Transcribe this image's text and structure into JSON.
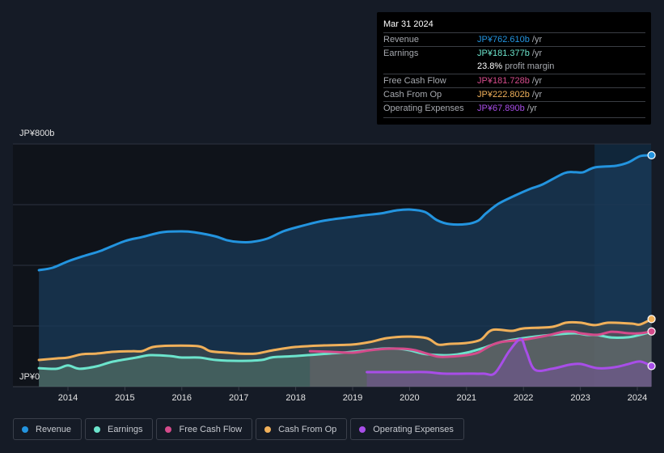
{
  "tooltip": {
    "date": "Mar 31 2024",
    "rows": [
      {
        "label": "Revenue",
        "value": "JP¥762.610b",
        "unit": " /yr",
        "color": "#2394df"
      },
      {
        "label": "Earnings",
        "value": "JP¥181.377b",
        "unit": " /yr",
        "color": "#6ce4cc"
      },
      {
        "label": "",
        "value": "23.8%",
        "unit": " profit margin",
        "color": "#ffffff"
      },
      {
        "label": "Free Cash Flow",
        "value": "JP¥181.728b",
        "unit": " /yr",
        "color": "#d44b8b"
      },
      {
        "label": "Cash From Op",
        "value": "JP¥222.802b",
        "unit": " /yr",
        "color": "#f0b05a"
      },
      {
        "label": "Operating Expenses",
        "value": "JP¥67.890b",
        "unit": " /yr",
        "color": "#a84ee8"
      }
    ]
  },
  "legend": [
    {
      "label": "Revenue",
      "color": "#2394df"
    },
    {
      "label": "Earnings",
      "color": "#6ce4cc"
    },
    {
      "label": "Free Cash Flow",
      "color": "#d44b8b"
    },
    {
      "label": "Cash From Op",
      "color": "#f0b05a"
    },
    {
      "label": "Operating Expenses",
      "color": "#a84ee8"
    }
  ],
  "chart_data": {
    "type": "area",
    "title": "",
    "xlabel": "",
    "ylabel": "",
    "y_unit": "JP¥ billions",
    "ylim": [
      0,
      800
    ],
    "xlim": [
      2013.49,
      2024.25
    ],
    "y_tick_labels": [
      "JP¥0",
      "JP¥800b"
    ],
    "y_gridlines": [
      0,
      200,
      400,
      600,
      800
    ],
    "x_tick_labels": [
      "2014",
      "2015",
      "2016",
      "2017",
      "2018",
      "2019",
      "2020",
      "2021",
      "2022",
      "2023",
      "2024"
    ],
    "x_ticks": [
      2014,
      2015,
      2016,
      2017,
      2018,
      2019,
      2020,
      2021,
      2022,
      2023,
      2024
    ],
    "highlight_from": 2023.25,
    "legend_position": "bottom",
    "series": [
      {
        "name": "Revenue",
        "color": "#2394df",
        "points": [
          [
            2013.49,
            384
          ],
          [
            2013.73,
            392
          ],
          [
            2014.0,
            413
          ],
          [
            2014.3,
            432
          ],
          [
            2014.58,
            448
          ],
          [
            2015.0,
            480
          ],
          [
            2015.3,
            493
          ],
          [
            2015.65,
            509
          ],
          [
            2016.0,
            512
          ],
          [
            2016.22,
            509
          ],
          [
            2016.58,
            496
          ],
          [
            2016.79,
            483
          ],
          [
            2017.0,
            477
          ],
          [
            2017.22,
            477
          ],
          [
            2017.5,
            488
          ],
          [
            2017.78,
            512
          ],
          [
            2018.07,
            528
          ],
          [
            2018.49,
            547
          ],
          [
            2019.0,
            560
          ],
          [
            2019.2,
            565
          ],
          [
            2019.49,
            571
          ],
          [
            2019.77,
            581
          ],
          [
            2020.0,
            584
          ],
          [
            2020.27,
            576
          ],
          [
            2020.48,
            549
          ],
          [
            2020.7,
            536
          ],
          [
            2021.0,
            536
          ],
          [
            2021.2,
            547
          ],
          [
            2021.34,
            571
          ],
          [
            2021.56,
            603
          ],
          [
            2021.84,
            629
          ],
          [
            2022.13,
            653
          ],
          [
            2022.34,
            667
          ],
          [
            2022.72,
            704
          ],
          [
            2022.91,
            707
          ],
          [
            2023.05,
            707
          ],
          [
            2023.26,
            723
          ],
          [
            2023.62,
            728
          ],
          [
            2023.84,
            739
          ],
          [
            2024.05,
            760
          ],
          [
            2024.25,
            763
          ]
        ]
      },
      {
        "name": "Earnings",
        "color": "#6ce4cc",
        "points": [
          [
            2013.49,
            61
          ],
          [
            2013.8,
            59
          ],
          [
            2014.0,
            70
          ],
          [
            2014.2,
            59
          ],
          [
            2014.5,
            67
          ],
          [
            2014.8,
            83
          ],
          [
            2015.2,
            96
          ],
          [
            2015.45,
            104
          ],
          [
            2015.8,
            101
          ],
          [
            2016.0,
            96
          ],
          [
            2016.3,
            96
          ],
          [
            2016.6,
            88
          ],
          [
            2017.0,
            85
          ],
          [
            2017.4,
            88
          ],
          [
            2017.6,
            97
          ],
          [
            2018.0,
            101
          ],
          [
            2018.5,
            108
          ],
          [
            2019.0,
            115
          ],
          [
            2019.5,
            125
          ],
          [
            2019.8,
            125
          ],
          [
            2020.0,
            120
          ],
          [
            2020.3,
            107
          ],
          [
            2020.7,
            104
          ],
          [
            2021.0,
            112
          ],
          [
            2021.3,
            128
          ],
          [
            2021.6,
            147
          ],
          [
            2022.0,
            160
          ],
          [
            2022.5,
            171
          ],
          [
            2022.9,
            176
          ],
          [
            2023.1,
            171
          ],
          [
            2023.3,
            170
          ],
          [
            2023.55,
            162
          ],
          [
            2023.85,
            163
          ],
          [
            2024.05,
            171
          ],
          [
            2024.25,
            181
          ]
        ]
      },
      {
        "name": "Free Cash Flow",
        "color": "#d44b8b",
        "points": [
          [
            2018.25,
            117
          ],
          [
            2018.6,
            115
          ],
          [
            2019.0,
            112
          ],
          [
            2019.3,
            120
          ],
          [
            2019.6,
            125
          ],
          [
            2019.9,
            125
          ],
          [
            2020.1,
            120
          ],
          [
            2020.3,
            109
          ],
          [
            2020.5,
            99
          ],
          [
            2020.7,
            99
          ],
          [
            2021.0,
            104
          ],
          [
            2021.2,
            112
          ],
          [
            2021.4,
            133
          ],
          [
            2021.6,
            147
          ],
          [
            2022.0,
            155
          ],
          [
            2022.4,
            168
          ],
          [
            2022.7,
            181
          ],
          [
            2022.9,
            181
          ],
          [
            2023.0,
            176
          ],
          [
            2023.3,
            171
          ],
          [
            2023.55,
            181
          ],
          [
            2023.85,
            176
          ],
          [
            2024.05,
            176
          ],
          [
            2024.25,
            182
          ]
        ]
      },
      {
        "name": "Cash From Op",
        "color": "#f0b05a",
        "points": [
          [
            2013.49,
            88
          ],
          [
            2013.8,
            93
          ],
          [
            2014.0,
            96
          ],
          [
            2014.25,
            107
          ],
          [
            2014.5,
            109
          ],
          [
            2014.8,
            115
          ],
          [
            2015.15,
            117
          ],
          [
            2015.3,
            117
          ],
          [
            2015.5,
            131
          ],
          [
            2015.8,
            135
          ],
          [
            2016.3,
            133
          ],
          [
            2016.5,
            117
          ],
          [
            2016.8,
            112
          ],
          [
            2017.0,
            109
          ],
          [
            2017.3,
            109
          ],
          [
            2017.6,
            120
          ],
          [
            2018.0,
            131
          ],
          [
            2018.5,
            136
          ],
          [
            2019.0,
            139
          ],
          [
            2019.3,
            147
          ],
          [
            2019.6,
            160
          ],
          [
            2019.95,
            165
          ],
          [
            2020.3,
            160
          ],
          [
            2020.5,
            139
          ],
          [
            2020.7,
            141
          ],
          [
            2021.0,
            144
          ],
          [
            2021.25,
            155
          ],
          [
            2021.45,
            187
          ],
          [
            2021.8,
            184
          ],
          [
            2022.0,
            192
          ],
          [
            2022.5,
            197
          ],
          [
            2022.75,
            211
          ],
          [
            2023.0,
            211
          ],
          [
            2023.25,
            203
          ],
          [
            2023.5,
            211
          ],
          [
            2023.9,
            208
          ],
          [
            2024.05,
            205
          ],
          [
            2024.25,
            223
          ]
        ]
      },
      {
        "name": "Operating Expenses",
        "color": "#a84ee8",
        "points": [
          [
            2019.25,
            48
          ],
          [
            2019.6,
            48
          ],
          [
            2020.0,
            48
          ],
          [
            2020.3,
            48
          ],
          [
            2020.6,
            43
          ],
          [
            2021.0,
            43
          ],
          [
            2021.3,
            43
          ],
          [
            2021.5,
            45
          ],
          [
            2021.75,
            117
          ],
          [
            2021.95,
            157
          ],
          [
            2022.05,
            117
          ],
          [
            2022.2,
            56
          ],
          [
            2022.5,
            59
          ],
          [
            2022.8,
            72
          ],
          [
            2023.0,
            75
          ],
          [
            2023.3,
            61
          ],
          [
            2023.6,
            64
          ],
          [
            2023.85,
            75
          ],
          [
            2024.05,
            83
          ],
          [
            2024.25,
            68
          ]
        ]
      }
    ]
  }
}
